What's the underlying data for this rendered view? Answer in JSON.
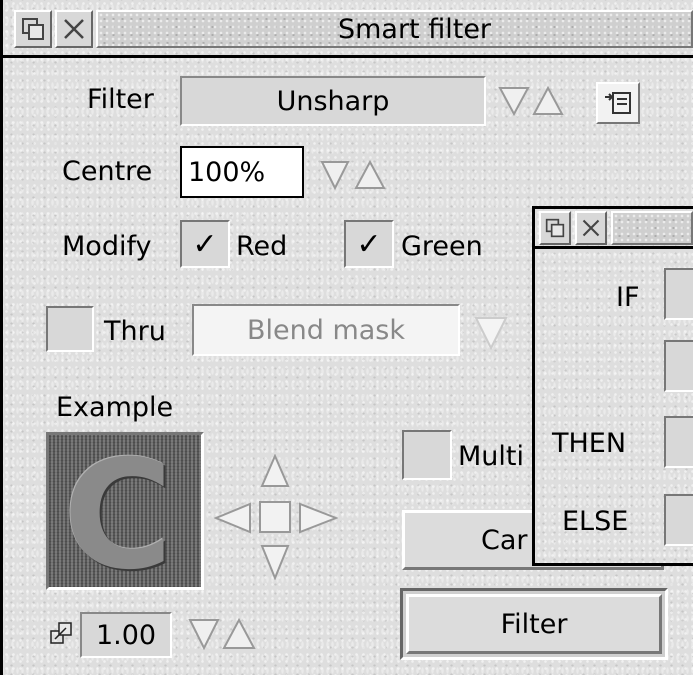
{
  "window": {
    "title": "Smart filter"
  },
  "filter": {
    "label": "Filter",
    "value": "Unsharp"
  },
  "centre": {
    "label": "Centre",
    "value": "100%"
  },
  "modify": {
    "label": "Modify",
    "red_label": "Red",
    "green_label": "Green",
    "red_checked": true,
    "green_checked": true,
    "check_glyph": "✓"
  },
  "thru": {
    "label": "Thru",
    "value": "Blend mask",
    "checked": false
  },
  "example": {
    "label": "Example",
    "preview_letter": "C"
  },
  "multi": {
    "label": "Multi",
    "checked": false
  },
  "buttons": {
    "cancel_partial": "Car",
    "filter": "Filter"
  },
  "scale": {
    "value": "1.00"
  },
  "popup": {
    "if_label": "IF",
    "then_label": "THEN",
    "else_label": "ELSE"
  }
}
